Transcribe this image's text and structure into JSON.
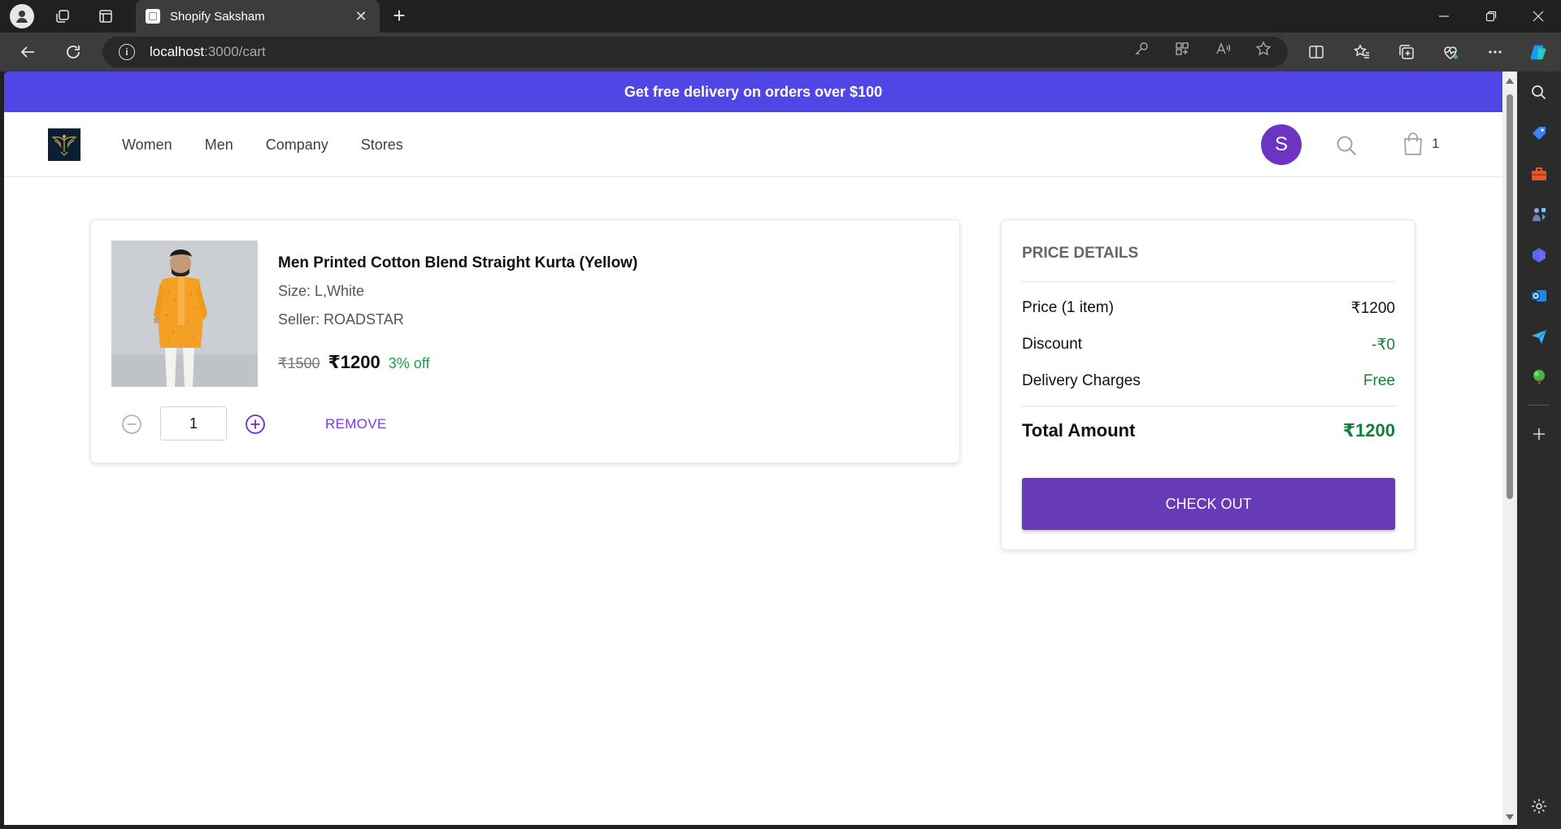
{
  "browser": {
    "tab_title": "Shopify Saksham",
    "url_host": "localhost",
    "url_path": ":3000/cart"
  },
  "promo": {
    "text": "Get free delivery on orders over $100"
  },
  "header": {
    "menu": [
      "Women",
      "Men",
      "Company",
      "Stores"
    ],
    "avatar_letter": "S",
    "cart_count": "1"
  },
  "cart_item": {
    "title": "Men Printed Cotton Blend Straight Kurta (Yellow)",
    "size": "Size: L,White",
    "seller": "Seller: ROADSTAR",
    "mrp": "₹1500",
    "price": "₹1200",
    "discount": "3% off",
    "quantity": "1",
    "remove_label": "REMOVE"
  },
  "price_details": {
    "title": "PRICE DETAILS",
    "price_label": "Price (1 item)",
    "price_value": "₹1200",
    "discount_label": "Discount",
    "discount_value": "-₹0",
    "delivery_label": "Delivery Charges",
    "delivery_value": "Free",
    "total_label": "Total Amount",
    "total_value": "₹1200",
    "checkout_label": "CHECK OUT"
  },
  "colors": {
    "promo_bg": "#4f46e5",
    "checkout_bg": "#673ab7",
    "avatar_bg": "#6b34c2",
    "green": "#15803d",
    "remove": "#7c3aed"
  }
}
